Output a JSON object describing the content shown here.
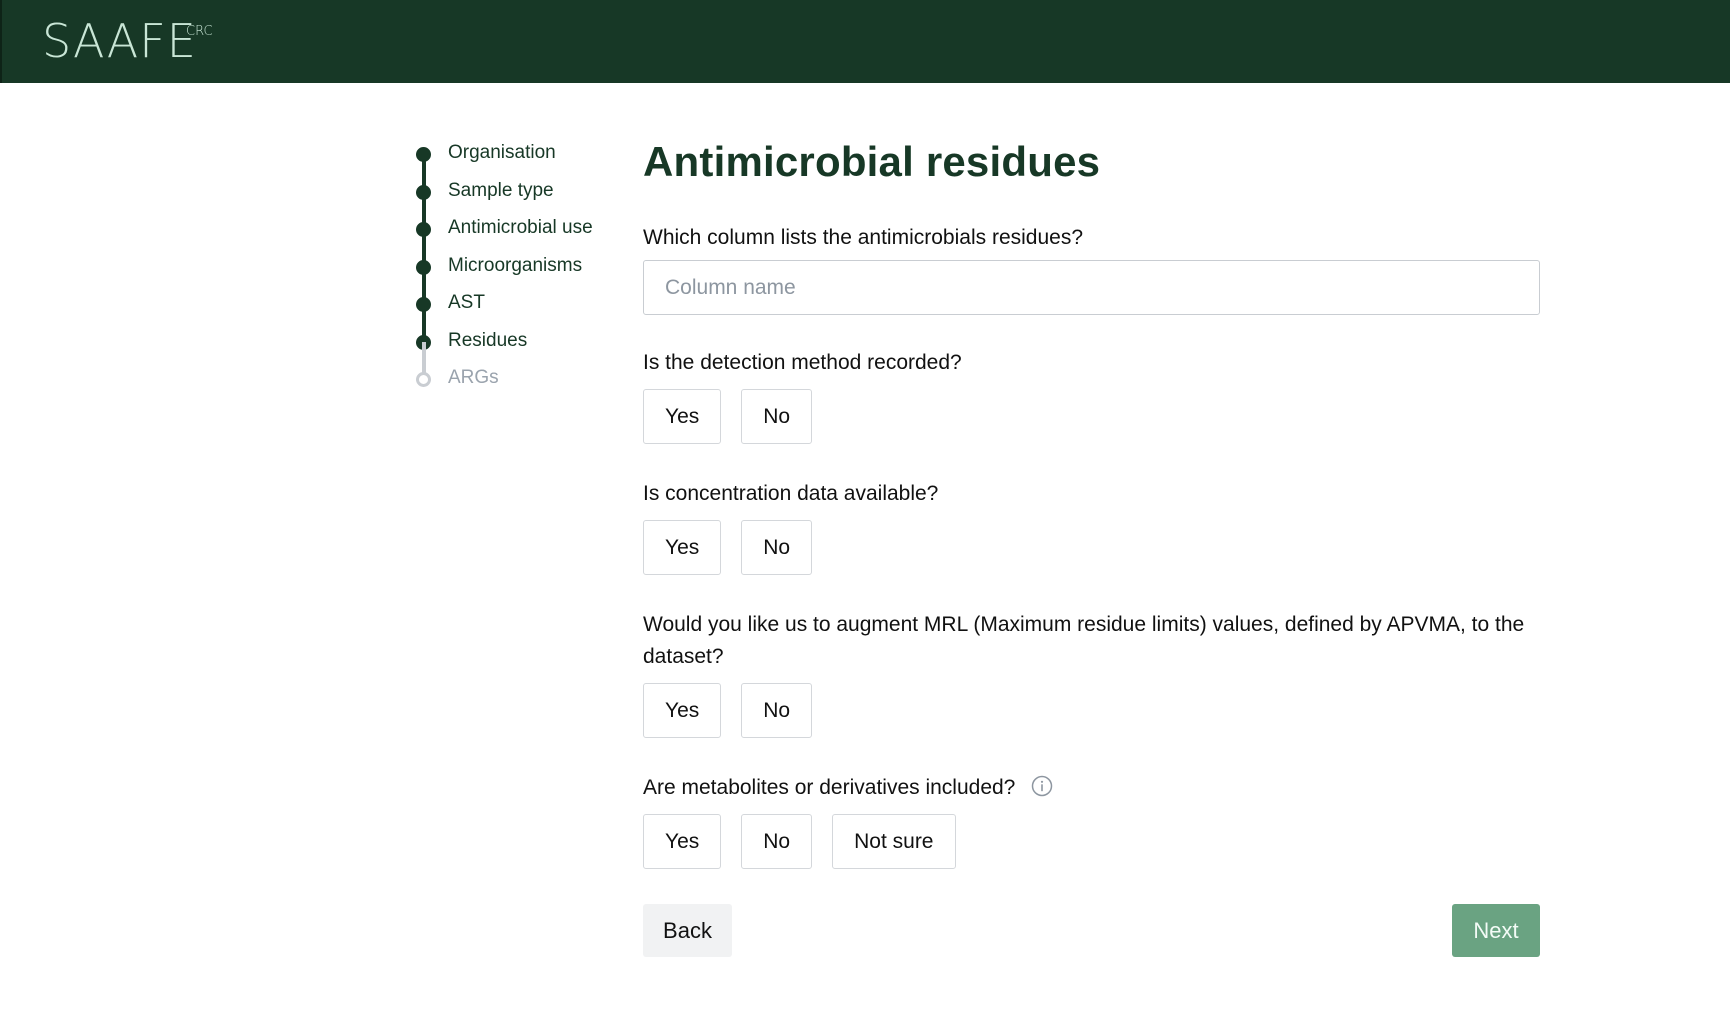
{
  "header": {
    "logo_text": "SAAFE",
    "logo_sup": "CRC"
  },
  "stepper": {
    "steps": [
      {
        "label": "Organisation",
        "state": "complete"
      },
      {
        "label": "Sample type",
        "state": "complete"
      },
      {
        "label": "Antimicrobial use",
        "state": "complete"
      },
      {
        "label": "Microorganisms",
        "state": "complete"
      },
      {
        "label": "AST",
        "state": "complete"
      },
      {
        "label": "Residues",
        "state": "current"
      },
      {
        "label": "ARGs",
        "state": "upcoming"
      }
    ]
  },
  "page": {
    "title": "Antimicrobial residues"
  },
  "form": {
    "q1": {
      "label": "Which column lists the antimicrobials residues?",
      "placeholder": "Column name",
      "value": ""
    },
    "q2": {
      "label": "Is the detection method recorded?",
      "yes": "Yes",
      "no": "No"
    },
    "q3": {
      "label": "Is concentration data available?",
      "yes": "Yes",
      "no": "No"
    },
    "q4": {
      "label": "Would you like us to augment MRL (Maximum residue limits) values, defined by APVMA, to the dataset?",
      "yes": "Yes",
      "no": "No"
    },
    "q5": {
      "label": "Are metabolites or derivatives included?",
      "yes": "Yes",
      "no": "No",
      "not_sure": "Not sure",
      "icon": "info-icon"
    }
  },
  "nav": {
    "back_label": "Back",
    "next_label": "Next"
  },
  "colors": {
    "brand_dark": "#173826",
    "logo": "#c9e6d6",
    "next_button": "#6aa382",
    "back_button": "#f1f2f3",
    "inactive_step": "#c9cdd2"
  }
}
